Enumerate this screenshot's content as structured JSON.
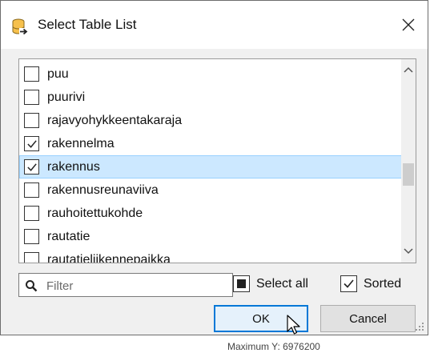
{
  "window": {
    "title": "Select Table List"
  },
  "list": {
    "items": [
      {
        "label": "puu",
        "checked": false,
        "selected": false
      },
      {
        "label": "puurivi",
        "checked": false,
        "selected": false
      },
      {
        "label": "rajavyohykkeentakaraja",
        "checked": false,
        "selected": false
      },
      {
        "label": "rakennelma",
        "checked": true,
        "selected": false
      },
      {
        "label": "rakennus",
        "checked": true,
        "selected": true
      },
      {
        "label": "rakennusreunaviiva",
        "checked": false,
        "selected": false
      },
      {
        "label": "rauhoitettukohde",
        "checked": false,
        "selected": false
      },
      {
        "label": "rautatie",
        "checked": false,
        "selected": false
      },
      {
        "label": "rautatieliikennepaikka",
        "checked": false,
        "selected": false
      }
    ]
  },
  "filter": {
    "placeholder": "Filter",
    "value": ""
  },
  "options": {
    "select_all_label": "Select all",
    "select_all_state": "partial",
    "sorted_label": "Sorted",
    "sorted_checked": true
  },
  "buttons": {
    "ok_label": "OK",
    "cancel_label": "Cancel"
  },
  "background": {
    "partial_text": "Maximum  Y: 6976200"
  },
  "colors": {
    "selection_bg": "#cce8ff",
    "selection_border": "#99d1ff",
    "default_button_border": "#0078d7"
  }
}
